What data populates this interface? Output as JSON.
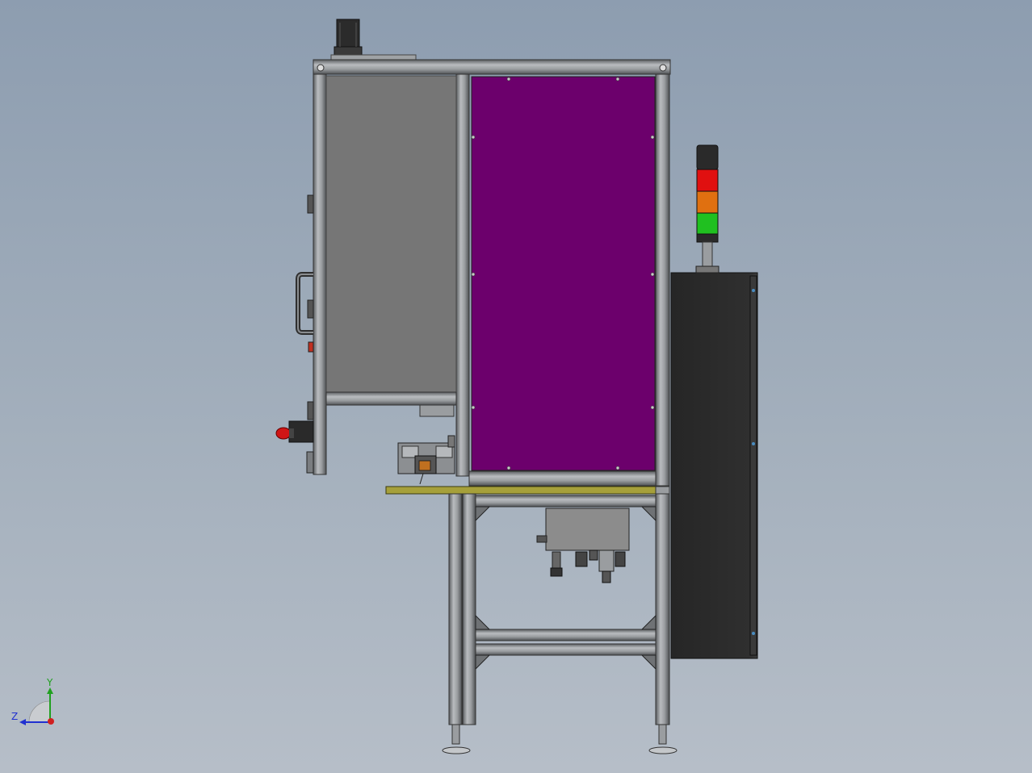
{
  "scene": {
    "background_top": "#8d9db0",
    "background_bottom": "#b6bec8"
  },
  "colors": {
    "frame_profile": "#8e9194",
    "frame_dark": "#3a3a3a",
    "grey_panel": "#767676",
    "purple_panel": "#6c006c",
    "control_cabinet": "#2d2d2d",
    "yellow_plate": "#a6a03a",
    "tower_red": "#e01010",
    "tower_orange": "#e07010",
    "tower_green": "#20c020",
    "motor": "#2b2b2b",
    "estop_red": "#d01515"
  },
  "triad": {
    "x_axis": "",
    "y_axis": "Y",
    "z_axis": "Z",
    "x_color": "#d02020",
    "y_color": "#20a020",
    "z_color": "#2030d0"
  },
  "icons": {
    "signal_tower": "stack-light-icon",
    "motor": "servo-motor-icon",
    "estop": "emergency-stop-icon",
    "handle": "door-handle-icon",
    "triad": "coordinate-triad-icon"
  }
}
